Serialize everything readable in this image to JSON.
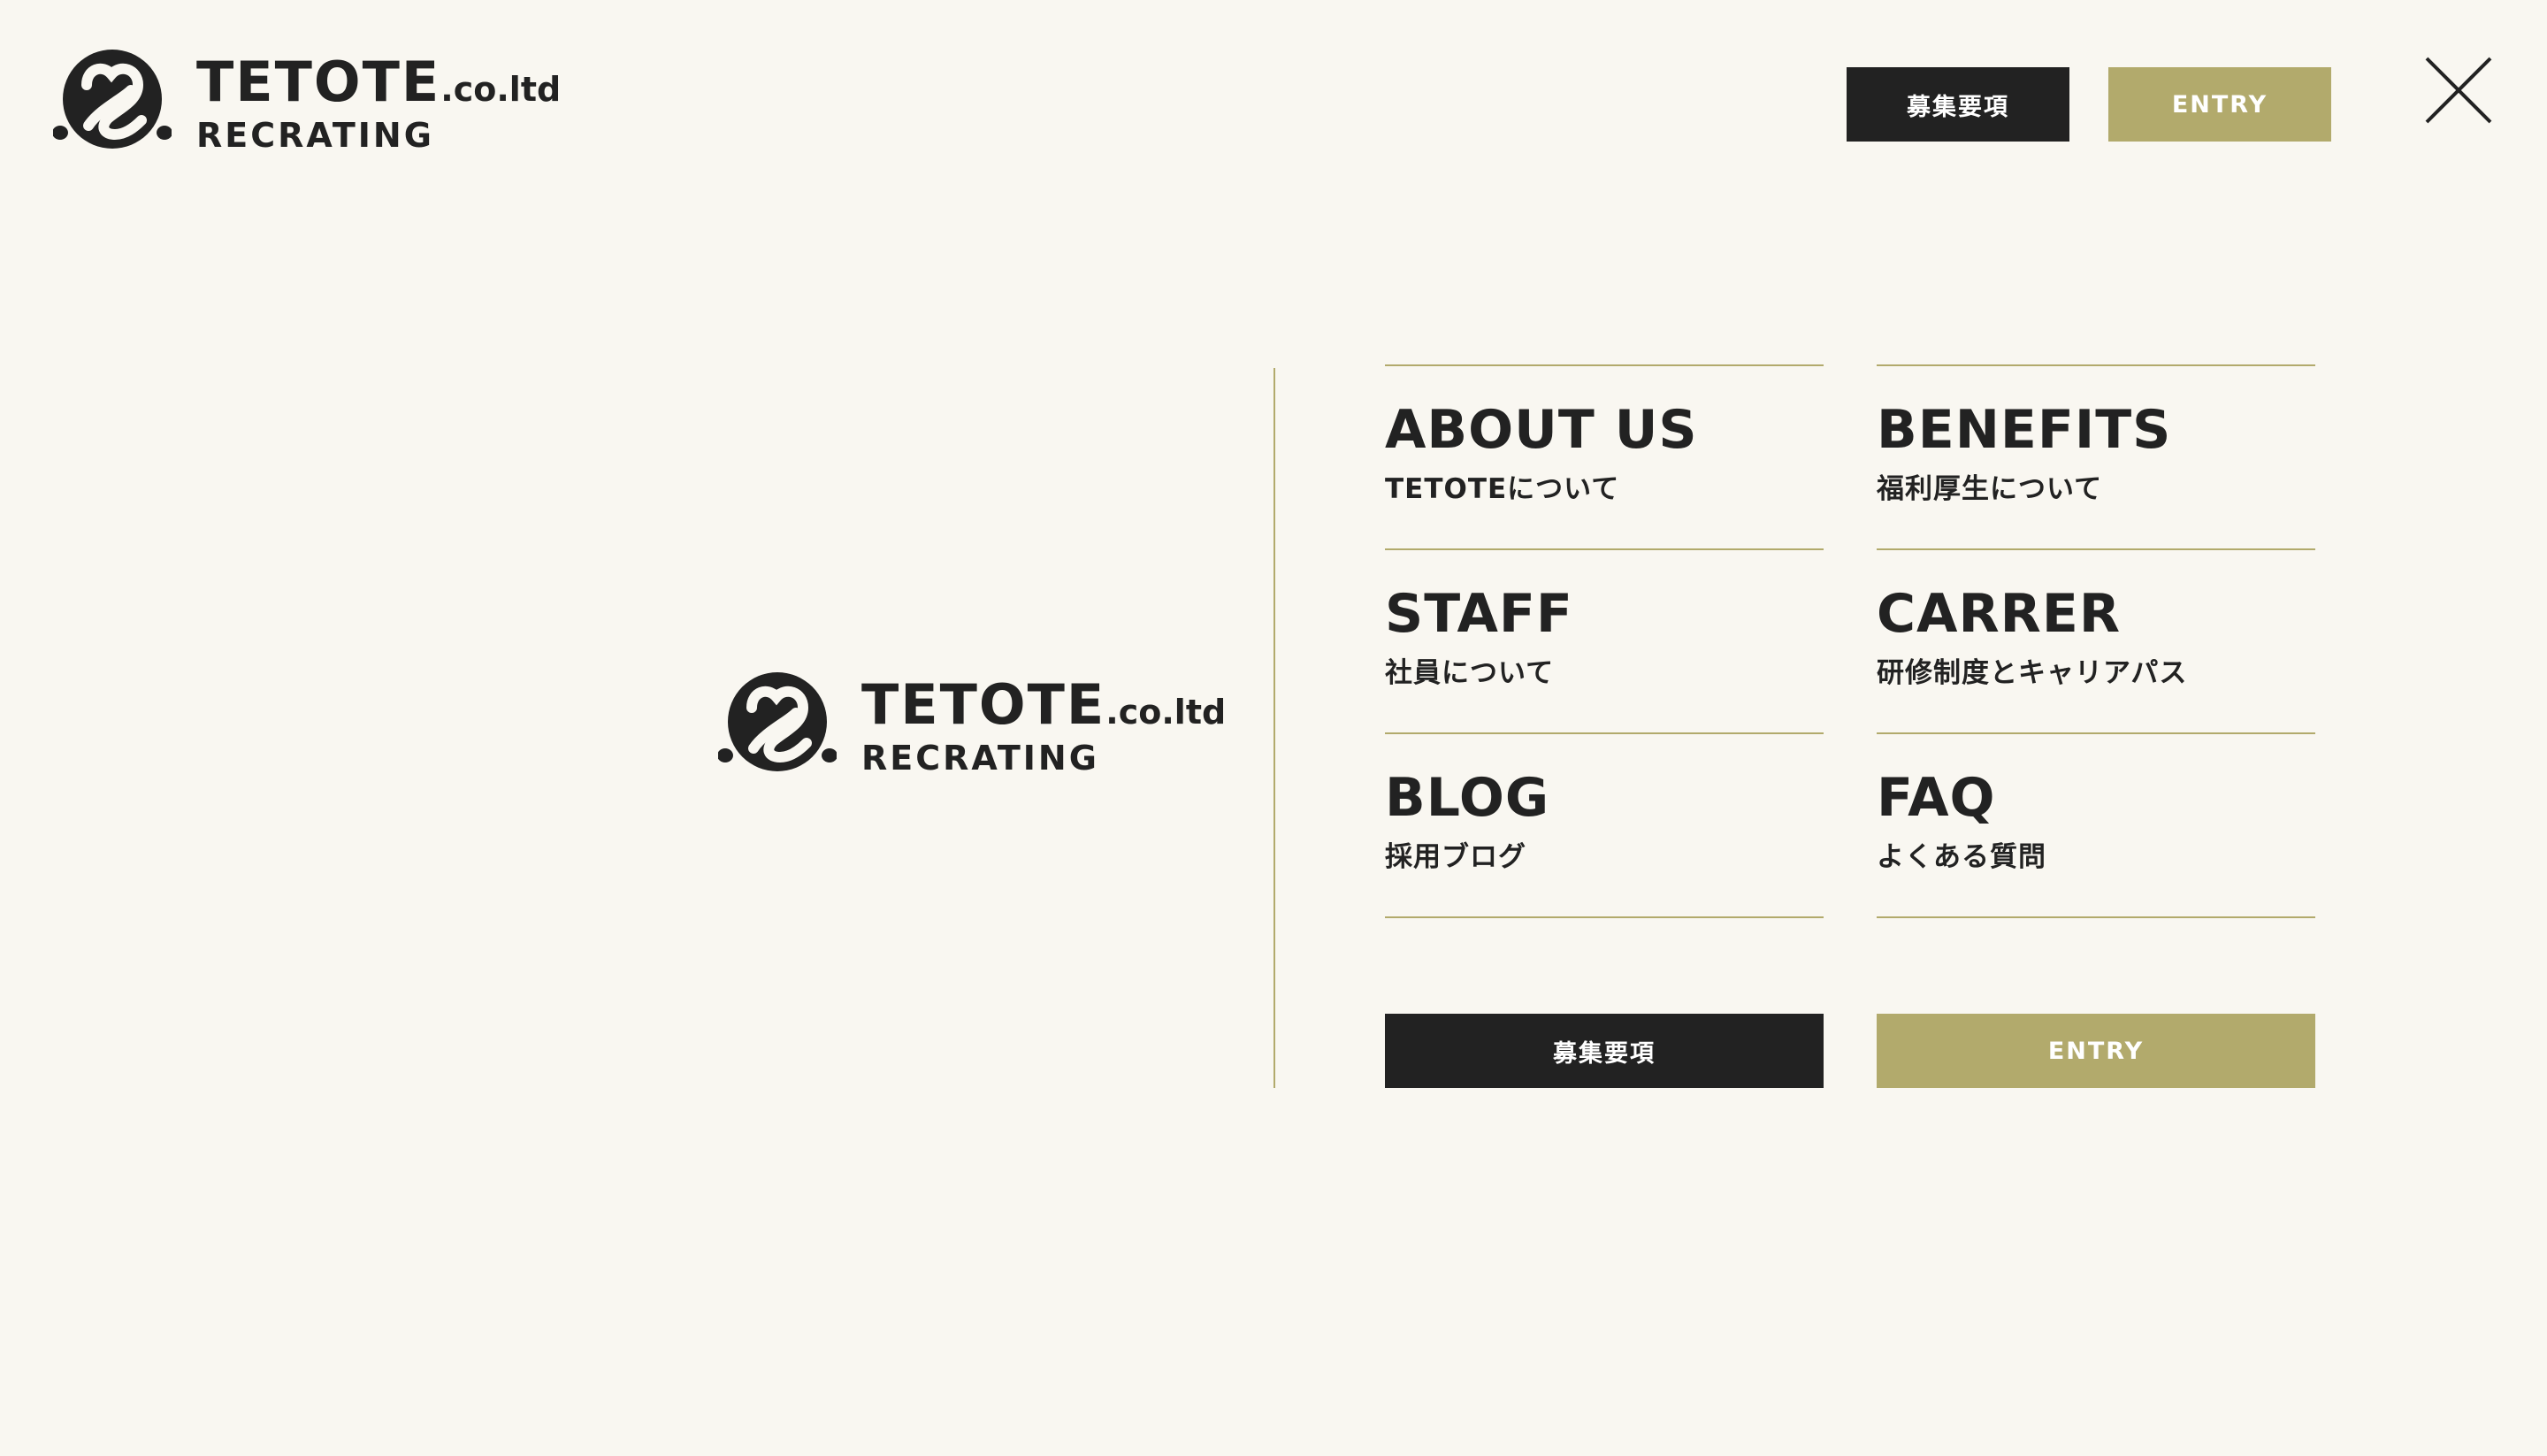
{
  "brand": {
    "name": "TETOTE",
    "suffix": ".co.ltd",
    "sub": "RECRATING"
  },
  "header": {
    "recruit_label": "募集要項",
    "entry_label": "ENTRY",
    "close_icon": "close-icon"
  },
  "nav": {
    "left": [
      {
        "en": "ABOUT US",
        "ja": "TETOTEについて"
      },
      {
        "en": "STAFF",
        "ja": "社員について"
      },
      {
        "en": "BLOG",
        "ja": "採用ブログ"
      }
    ],
    "right": [
      {
        "en": "BENEFITS",
        "ja": "福利厚生について"
      },
      {
        "en": "CARRER",
        "ja": "研修制度とキャリアパス"
      },
      {
        "en": "FAQ",
        "ja": "よくある質問"
      }
    ]
  },
  "menu_buttons": {
    "recruit_label": "募集要項",
    "entry_label": "ENTRY"
  },
  "colors": {
    "background": "#f9f7f1",
    "text": "#222222",
    "accent_gold": "#b2aa6c",
    "button_dark": "#222222"
  }
}
